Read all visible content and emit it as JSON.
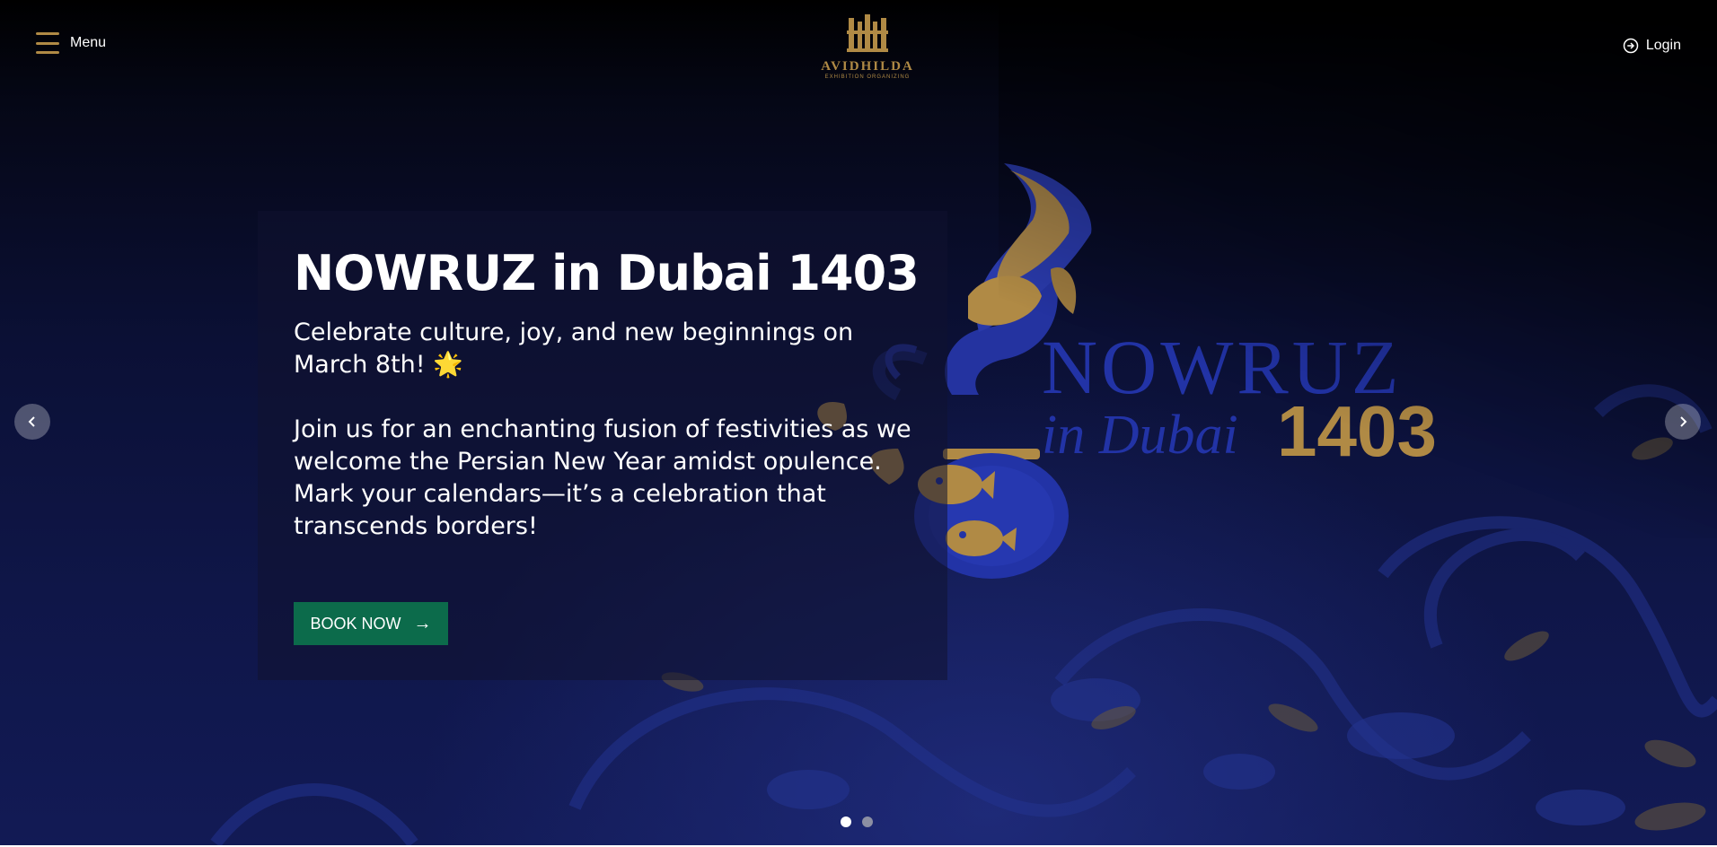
{
  "header": {
    "menu_label": "Menu",
    "login_label": "Login",
    "logo": {
      "brand": "AVIDHILDA",
      "subtitle": "EXHIBITION ORGANIZING"
    }
  },
  "hero": {
    "title": "NOWRUZ in Dubai 1403",
    "tagline": "Celebrate culture, joy, and new beginnings on March 8th! 🌟",
    "description": "Join us for an enchanting fusion of festivities as we welcome the Persian New Year amidst opulence. Mark your calendars—it’s a celebration that transcends borders!",
    "cta_label": "BOOK NOW",
    "artwork": {
      "word": "NOWRUZ",
      "in_city": "in Dubai",
      "year": "1403"
    }
  },
  "slider": {
    "total_slides": 2,
    "active_slide": 1
  },
  "colors": {
    "accent_gold": "#b08a45",
    "cta_green": "#0c6b4b",
    "art_blue": "#1f2f9a"
  },
  "icons": {
    "menu": "hamburger-icon",
    "login": "login-icon",
    "prev": "chevron-left-icon",
    "next": "chevron-right-icon",
    "cta": "arrow-right-icon"
  }
}
